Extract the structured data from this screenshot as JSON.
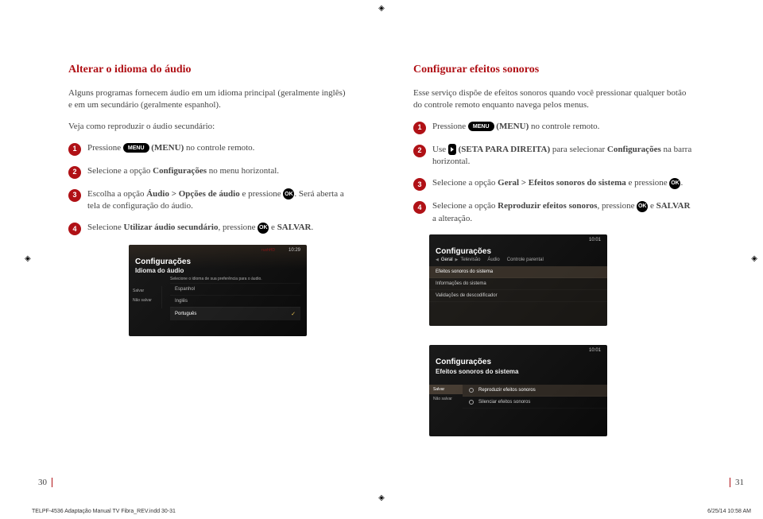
{
  "reg": "◈",
  "left": {
    "title": "Alterar o idioma do áudio",
    "intro1": "Alguns programas fornecem áudio em um idioma principal (geralmente inglês) e em um secundário (geralmente espanhol).",
    "intro2": "Veja como reproduzir o áudio secundário:",
    "steps": {
      "s1_pre": "Pressione ",
      "s1_pill": "MENU",
      "s1_post_bold": " (MENU)",
      "s1_post": " no controle remoto.",
      "s2_pre": "Selecione a opção ",
      "s2_bold": "Configurações",
      "s2_post": " no menu horizontal.",
      "s3_pre": "Escolha a opção ",
      "s3_bold": "Áudio > Opções de áudio",
      "s3_mid": " e pressione ",
      "s3_pill": "OK",
      "s3_post": ". Será aberta a tela de configuração do áudio.",
      "s4_pre": "Selecione ",
      "s4_bold": "Utilizar áudio secundário",
      "s4_mid": ", pressione ",
      "s4_pill": "OK",
      "s4_post": " e ",
      "s4_bold2": "SALVAR",
      "s4_dot": "."
    },
    "screen": {
      "time": "10:29",
      "net": "rushHD",
      "title": "Configurações",
      "sub": "Idioma do áudio",
      "desc": "Selecione o idioma de sua preferência para o áudio.",
      "side": [
        "Salvar",
        "Não salvar"
      ],
      "items": [
        "Espanhol",
        "Inglês",
        "Português"
      ]
    }
  },
  "right": {
    "title": "Configurar efeitos sonoros",
    "intro1": "Esse serviço dispõe de efeitos sonoros quando você pressionar qualquer botão do controle remoto enquanto navega pelos menus.",
    "steps": {
      "s1_pre": "Pressione ",
      "s1_pill": "MENU",
      "s1_post_bold": " (MENU)",
      "s1_post": " no controle remoto.",
      "s2_pre": "Use ",
      "s2_post_bold": " (SETA PARA DIREITA)",
      "s2_mid": " para selecionar ",
      "s2_bold": "Configurações",
      "s2_post": " na barra horizontal.",
      "s3_pre": "Selecione a opção ",
      "s3_bold": "Geral > Efeitos sonoros do sistema",
      "s3_mid": " e pressione ",
      "s3_pill": "OK",
      "s3_dot": ".",
      "s4_pre": "Selecione a opção ",
      "s4_bold": "Reproduzir efeitos sonoros",
      "s4_mid": ", pressione ",
      "s4_pill": "OK",
      "s4_post": " e ",
      "s4_bold2": "SALVAR",
      "s4_post2": " a alteração."
    },
    "screen1": {
      "time": "10:01",
      "title": "Configurações",
      "crumb": [
        "Geral",
        "Televisão",
        "Áudio",
        "Controle parental"
      ],
      "rows": [
        "Efeitos sonoros do sistema",
        "Informações do sistema",
        "Validações de descodificador"
      ]
    },
    "screen2": {
      "time": "10:01",
      "title": "Configurações",
      "sub": "Efeitos sonoros do sistema",
      "side": [
        "Salvar",
        "Não salvar"
      ],
      "rows": [
        "Reproduzir efeitos sonoros",
        "Silenciar efeitos sonoros"
      ]
    }
  },
  "pages": {
    "left": "30",
    "right": "31"
  },
  "footer": {
    "file": "TELPF-4536 Adaptação Manual TV Fibra_REV.indd   30-31",
    "date": "6/25/14   10:58 AM"
  }
}
